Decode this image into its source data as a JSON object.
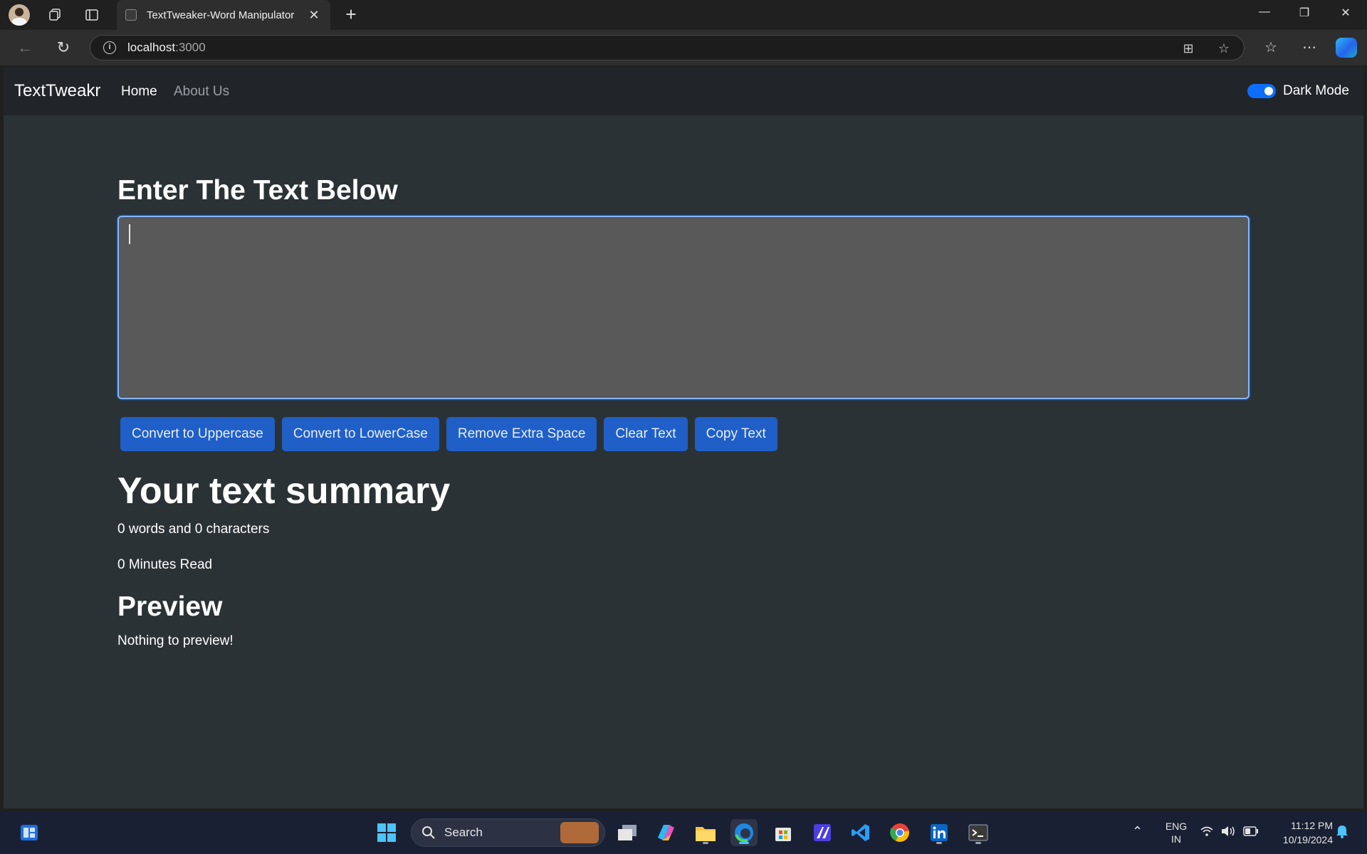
{
  "browser": {
    "tab_title": "TextTweaker-Word Manipulator",
    "url_host": "localhost",
    "url_port": ":3000"
  },
  "navbar": {
    "brand": "TextTweakr",
    "links": [
      {
        "label": "Home",
        "active": true
      },
      {
        "label": "About Us",
        "active": false
      }
    ],
    "dark_mode_label": "Dark Mode",
    "dark_mode_on": true
  },
  "form": {
    "heading": "Enter The Text Below",
    "textarea_value": ""
  },
  "buttons": [
    {
      "label": "Convert to Uppercase"
    },
    {
      "label": "Convert to LowerCase"
    },
    {
      "label": "Remove Extra Space"
    },
    {
      "label": "Clear Text"
    },
    {
      "label": "Copy Text"
    }
  ],
  "summary": {
    "heading": "Your text summary",
    "counts": "0 words and 0 characters",
    "read_time": "0 Minutes Read"
  },
  "preview": {
    "heading": "Preview",
    "text": "Nothing to preview!"
  },
  "taskbar": {
    "search_label": "Search",
    "lang_top": "ENG",
    "lang_bottom": "IN",
    "time": "11:12 PM",
    "date": "10/19/2024"
  },
  "colors": {
    "page_bg": "#2b3236",
    "navbar_bg": "#212529",
    "button_bg": "#1f5fc7",
    "textarea_bg": "#595959",
    "accent": "#0d6efd"
  }
}
